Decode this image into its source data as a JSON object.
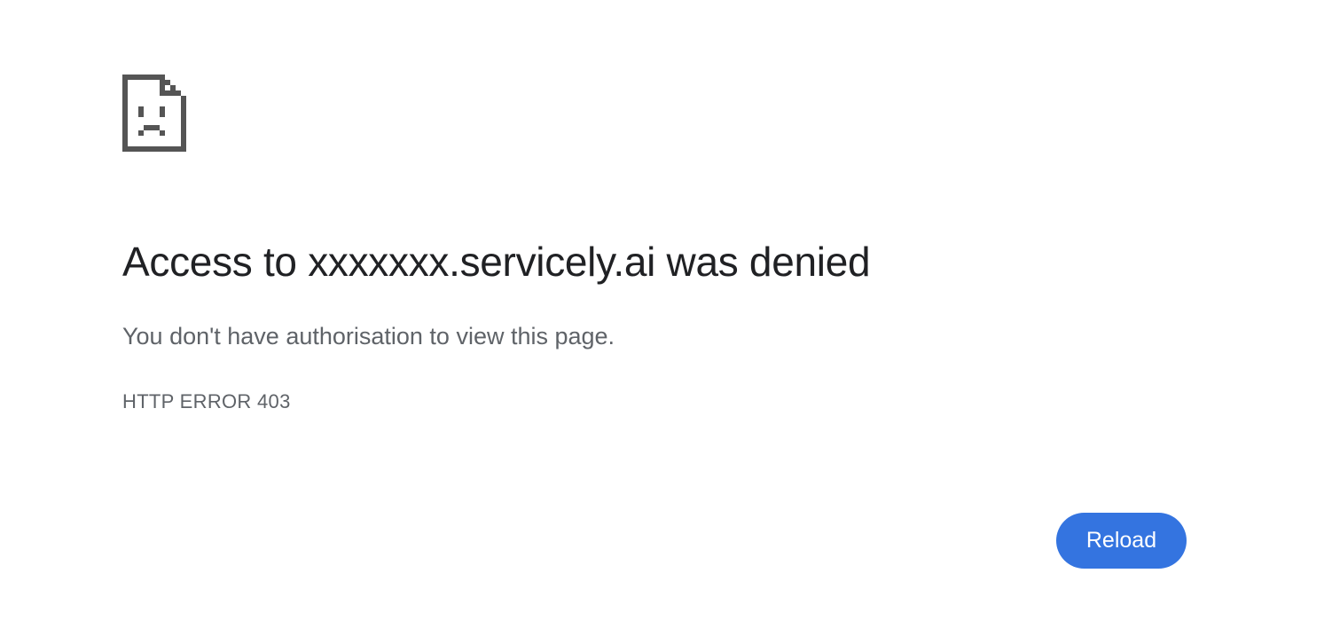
{
  "error": {
    "icon": "sad-page-icon",
    "headline": "Access to xxxxxxx.servicely.ai was denied",
    "message": "You don't have authorisation to view this page.",
    "code": "HTTP ERROR 403"
  },
  "actions": {
    "reload_label": "Reload"
  },
  "colors": {
    "accent": "#3474e0",
    "headline": "#202124",
    "secondary_text": "#5f6368",
    "icon": "#555555"
  }
}
